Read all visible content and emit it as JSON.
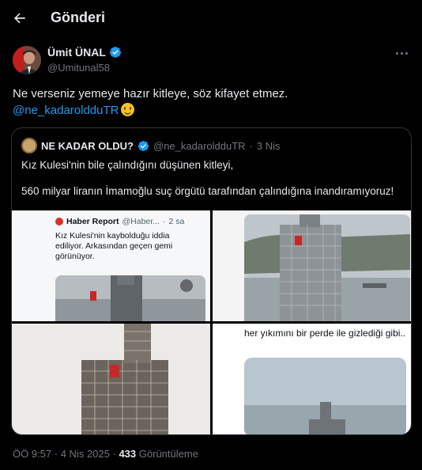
{
  "header": {
    "title": "Gönderi",
    "back_icon": "arrow-left-icon"
  },
  "post": {
    "author_name": "Ümit ÜNAL",
    "author_handle": "@Umitunal58",
    "text_line1": "Ne verseniz yemeye hazır kitleye, söz kifayet etmez.",
    "mention": "@ne_kadaroldduTR",
    "emoji": "smiling-face",
    "timestamp": "ÖÖ 9:57",
    "date": "4 Nis 2025",
    "views_count": "433",
    "views_label": "Görüntüleme"
  },
  "quote": {
    "author_name": "NE KADAR OLDU?",
    "author_handle": "@ne_kadaroldduTR",
    "time": "3 Nis",
    "paragraph1": "Kız Kulesi'nin bile çalındığını düşünen kitleyi,",
    "paragraph2": "560 milyar liranın İmamoğlu suç örgütü tarafından çalındığına inandıramıyoruz!",
    "media": {
      "cell1": {
        "source_name": "Haber Report",
        "source_handle": "@Haber...",
        "source_time": "2 sa",
        "text": "Kız Kulesi'nin kaybolduğu iddia ediliyor. Arkasından geçen gemi görünüyor."
      },
      "cell4": {
        "text": "her yıkımını bir perde ile gizlediği gibi.."
      }
    }
  },
  "colors": {
    "accent": "#1d9bf0",
    "background": "#000000",
    "muted": "#71767b"
  }
}
